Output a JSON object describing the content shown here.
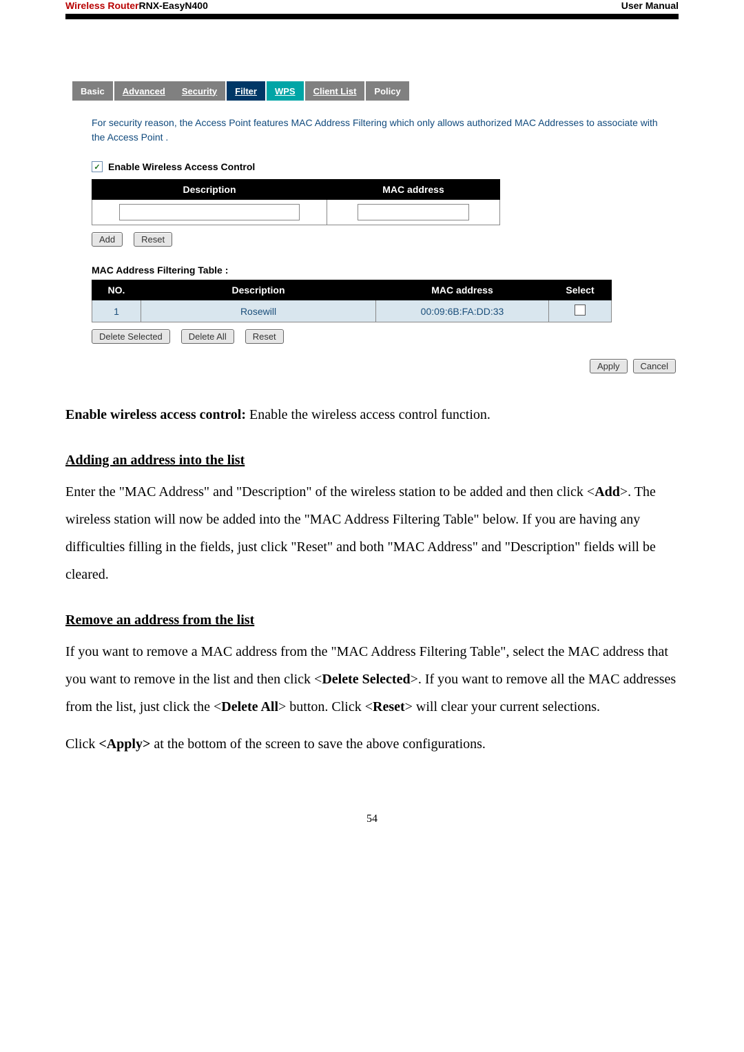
{
  "header": {
    "product_red": "Wireless Router",
    "product_rest": "RNX-EasyN400",
    "right": "User Manual"
  },
  "figure": {
    "tabs": {
      "basic": "Basic",
      "advanced": "Advanced",
      "security": "Security",
      "filter": "Filter",
      "wps": "WPS",
      "clientlist": "Client List",
      "policy": "Policy"
    },
    "intro": "For security reason, the Access Point features MAC Address Filtering which only allows authorized MAC Addresses to associate with the Access Point .",
    "checkbox_mark": "✓",
    "checkbox_label": "Enable Wireless Access Control",
    "table1": {
      "th_desc": "Description",
      "th_mac": "MAC address"
    },
    "btn_add": "Add",
    "btn_reset1": "Reset",
    "sub_head": "MAC Address Filtering Table :",
    "table2": {
      "th_no": "NO.",
      "th_desc": "Description",
      "th_mac": "MAC address",
      "th_sel": "Select",
      "row1_no": "1",
      "row1_desc": "Rosewill",
      "row1_mac": "00:09:6B:FA:DD:33"
    },
    "btn_delete_sel": "Delete Selected",
    "btn_delete_all": "Delete All",
    "btn_reset2": "Reset",
    "btn_apply": "Apply",
    "btn_cancel": "Cancel"
  },
  "text": {
    "p1a": "Enable wireless access control:",
    "p1b": " Enable the wireless access control function.",
    "h1": "Adding an address into the list",
    "p2a": "Enter the \"MAC Address\" and \"Description\" of the wireless station to be added and then click <",
    "p2b": "Add",
    "p2c": ">. The wireless station will now be added into the \"MAC Address Filtering Table\" below. If you are having any difficulties filling in the fields, just click \"Reset\" and both \"MAC Address\" and \"Description\" fields will be cleared.",
    "h2": "Remove an address from the list",
    "p3a": "If you want to remove a MAC address from the \"MAC Address Filtering Table\", select the MAC address that you want to remove in the list and then click <",
    "p3b": "Delete Selected",
    "p3c": ">. If you want to remove all the MAC addresses from the list, just click the <",
    "p3d": "Delete All",
    "p3e": "> button. Click <",
    "p3f": "Reset",
    "p3g": "> will clear your current selections.",
    "p4a": "Click ",
    "p4b": "<Apply>",
    "p4c": " at the bottom of the screen to save the above configurations.",
    "page_num": "54"
  }
}
